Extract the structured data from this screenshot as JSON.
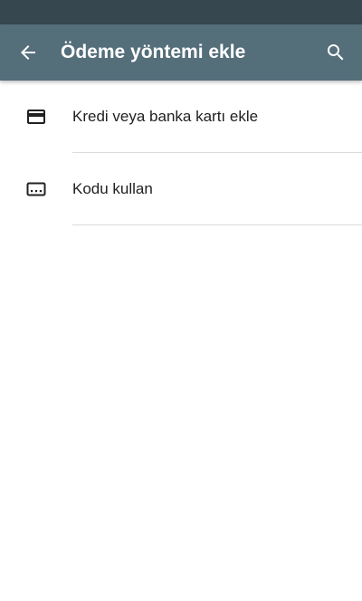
{
  "app_bar": {
    "title": "Ödeme yöntemi ekle",
    "back_icon": "arrow-back-icon",
    "search_icon": "search-icon",
    "background_color": "#546e7a",
    "status_bar_color": "#37474f"
  },
  "payment_options": [
    {
      "label": "Kredi veya banka kartı ekle",
      "icon": "credit-card-icon"
    },
    {
      "label": "Kodu kullan",
      "icon": "redeem-code-icon"
    }
  ]
}
